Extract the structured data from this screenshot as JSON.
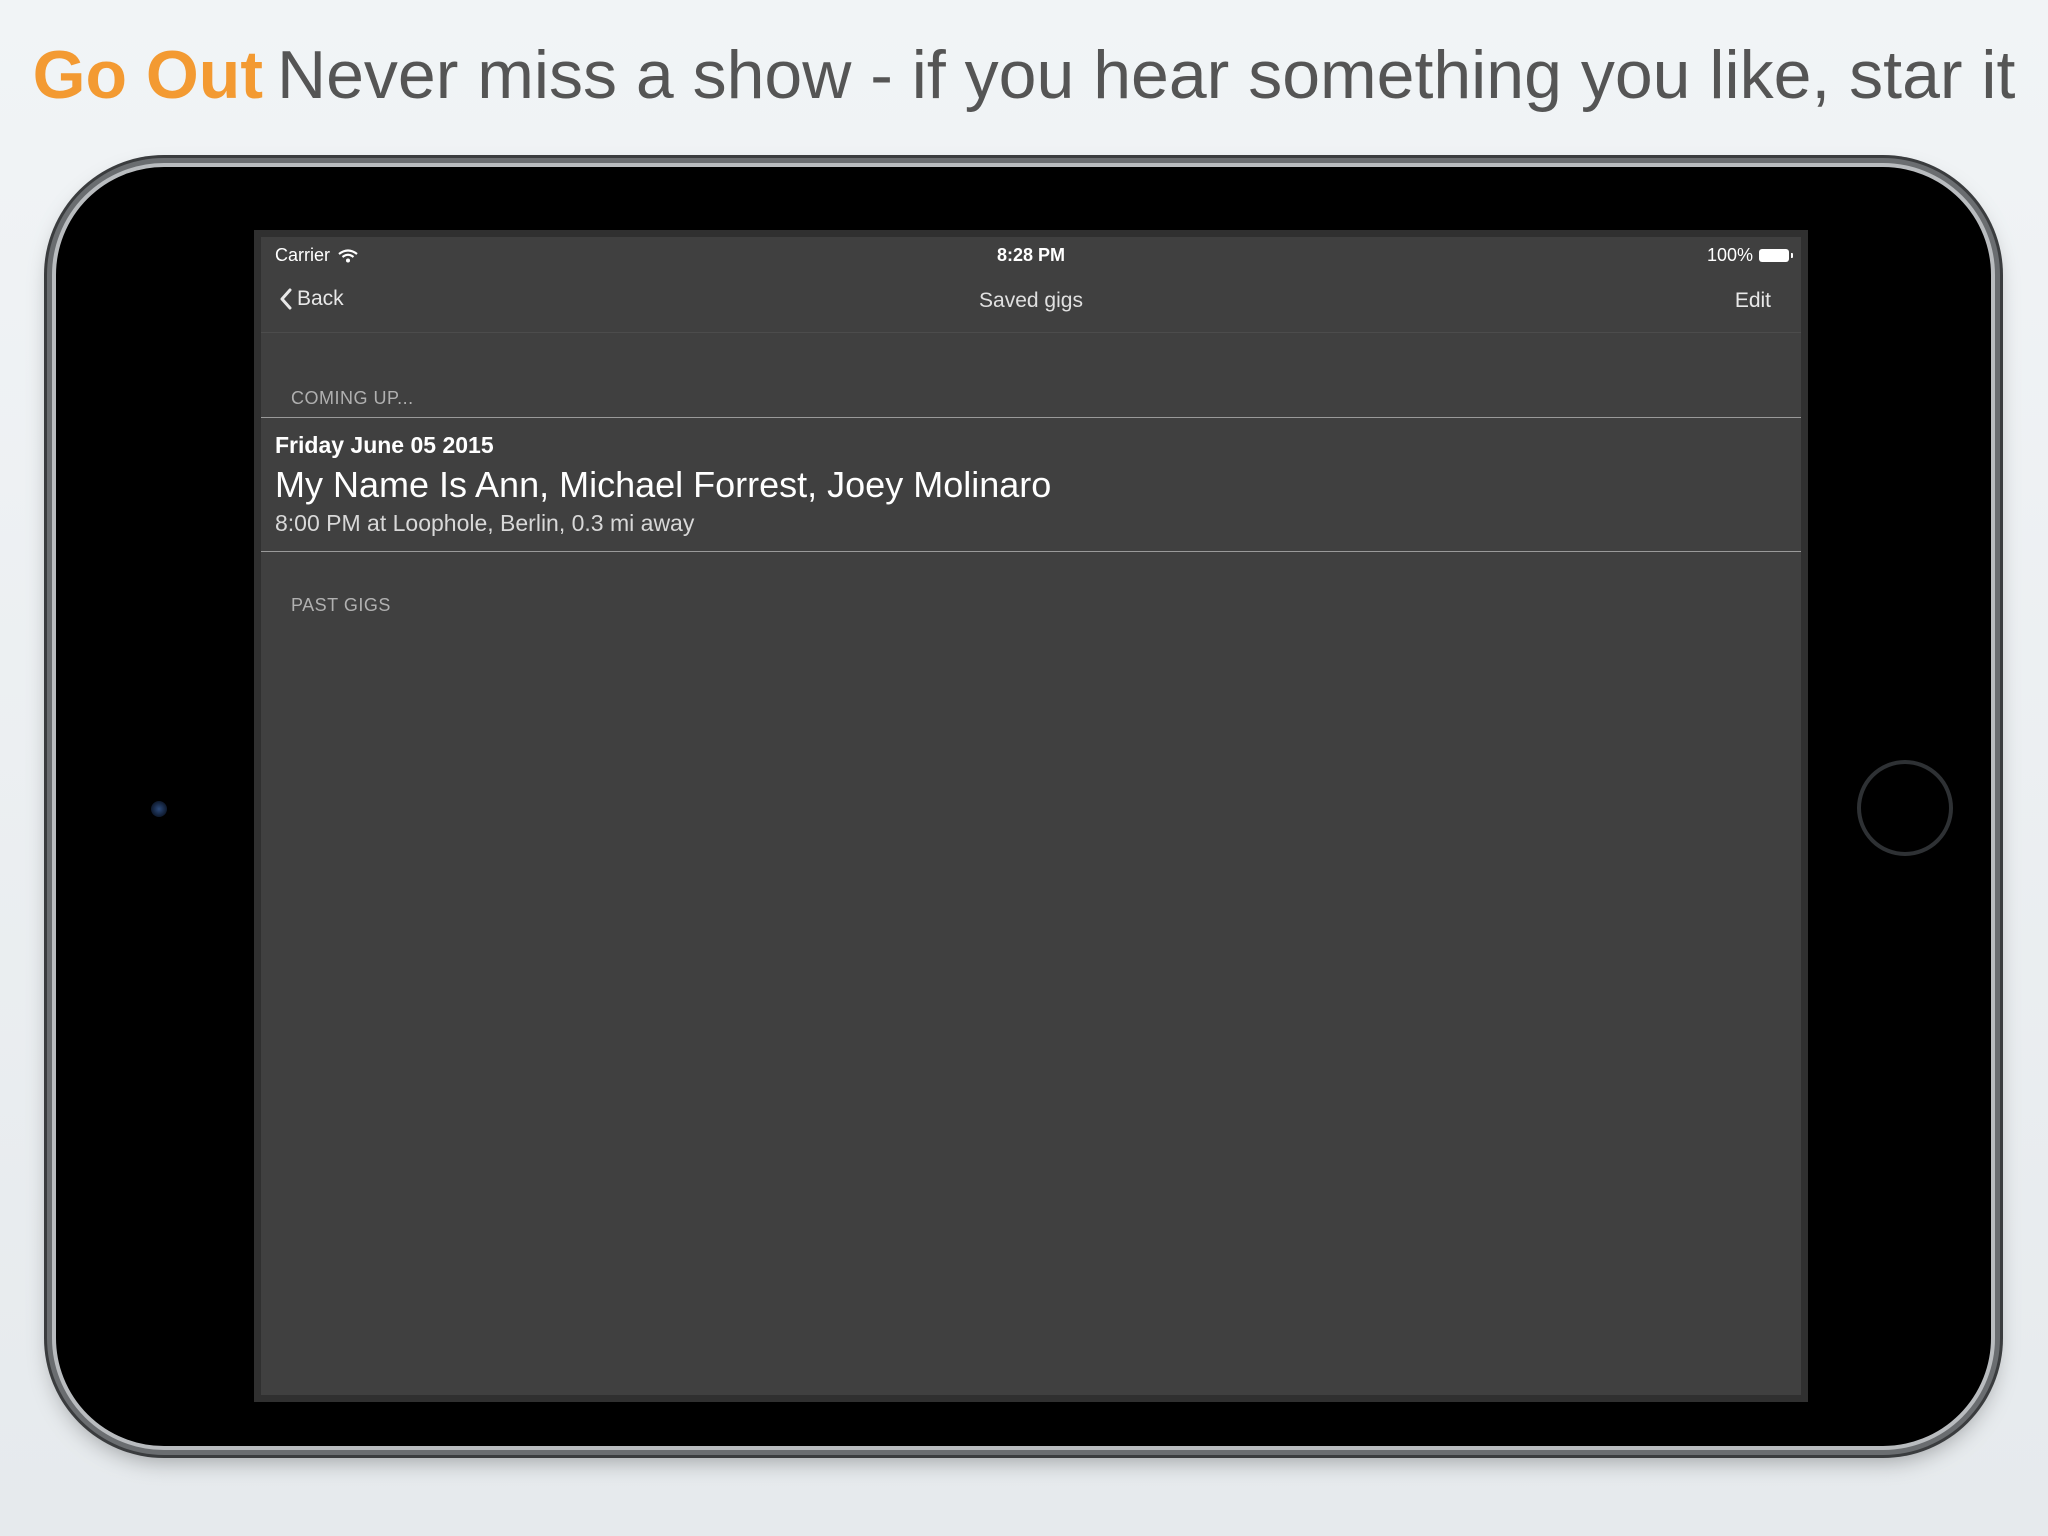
{
  "headline": {
    "brand": "Go Out",
    "tagline": "Never miss a show - if you hear something you like, star it"
  },
  "status_bar": {
    "carrier": "Carrier",
    "time": "8:28 PM",
    "battery": "100%"
  },
  "nav": {
    "back_label": "Back",
    "title": "Saved gigs",
    "edit_label": "Edit"
  },
  "sections": {
    "upcoming_header": "COMING UP...",
    "past_header": "PAST GIGS"
  },
  "gigs": [
    {
      "date": "Friday June 05 2015",
      "artists": "My Name Is Ann, Michael Forrest, Joey Molinaro",
      "detail": "8:00 PM at Loophole, Berlin, 0.3 mi away"
    }
  ],
  "colors": {
    "brand": "#f39a32",
    "screen_background": "#404040"
  }
}
